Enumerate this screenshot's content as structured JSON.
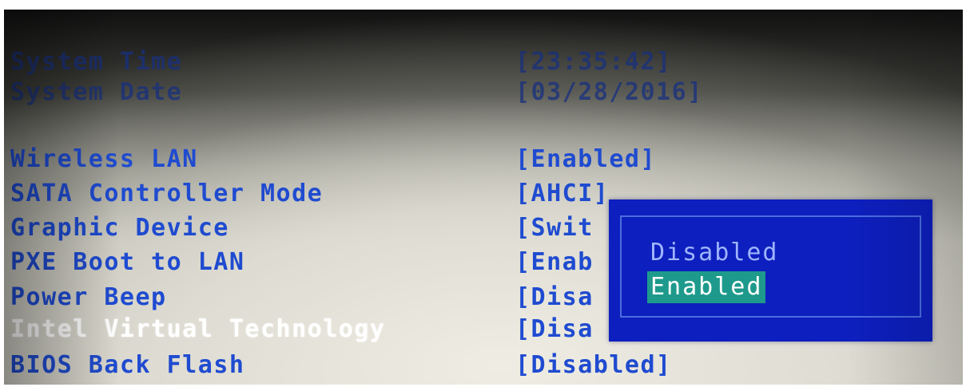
{
  "settings": [
    {
      "label": "System Time",
      "value": "[23:35:42]"
    },
    {
      "label": "System Date",
      "value": "[03/28/2016]"
    },
    {
      "label": "Wireless LAN",
      "value": "[Enabled]"
    },
    {
      "label": "SATA Controller Mode",
      "value": "[AHCI]"
    },
    {
      "label": "Graphic Device",
      "value": "[Swit"
    },
    {
      "label": "PXE Boot to LAN",
      "value": "[Enab"
    },
    {
      "label": "Power Beep",
      "value": "[Disa"
    },
    {
      "label": "Intel Virtual Technology",
      "value": "[Disa"
    },
    {
      "label": "BIOS Back Flash",
      "value": "[Disabled]"
    }
  ],
  "popup": {
    "options": [
      "Disabled",
      "Enabled"
    ],
    "selected": "Enabled"
  },
  "colors": {
    "label_text": "#1f4bd0",
    "selected_label_text": "#ffffff",
    "popup_background": "#0d1fbe",
    "popup_border": "#4b6de0",
    "option_text": "#9fb4ff",
    "highlight_background": "#1e9a8c"
  }
}
